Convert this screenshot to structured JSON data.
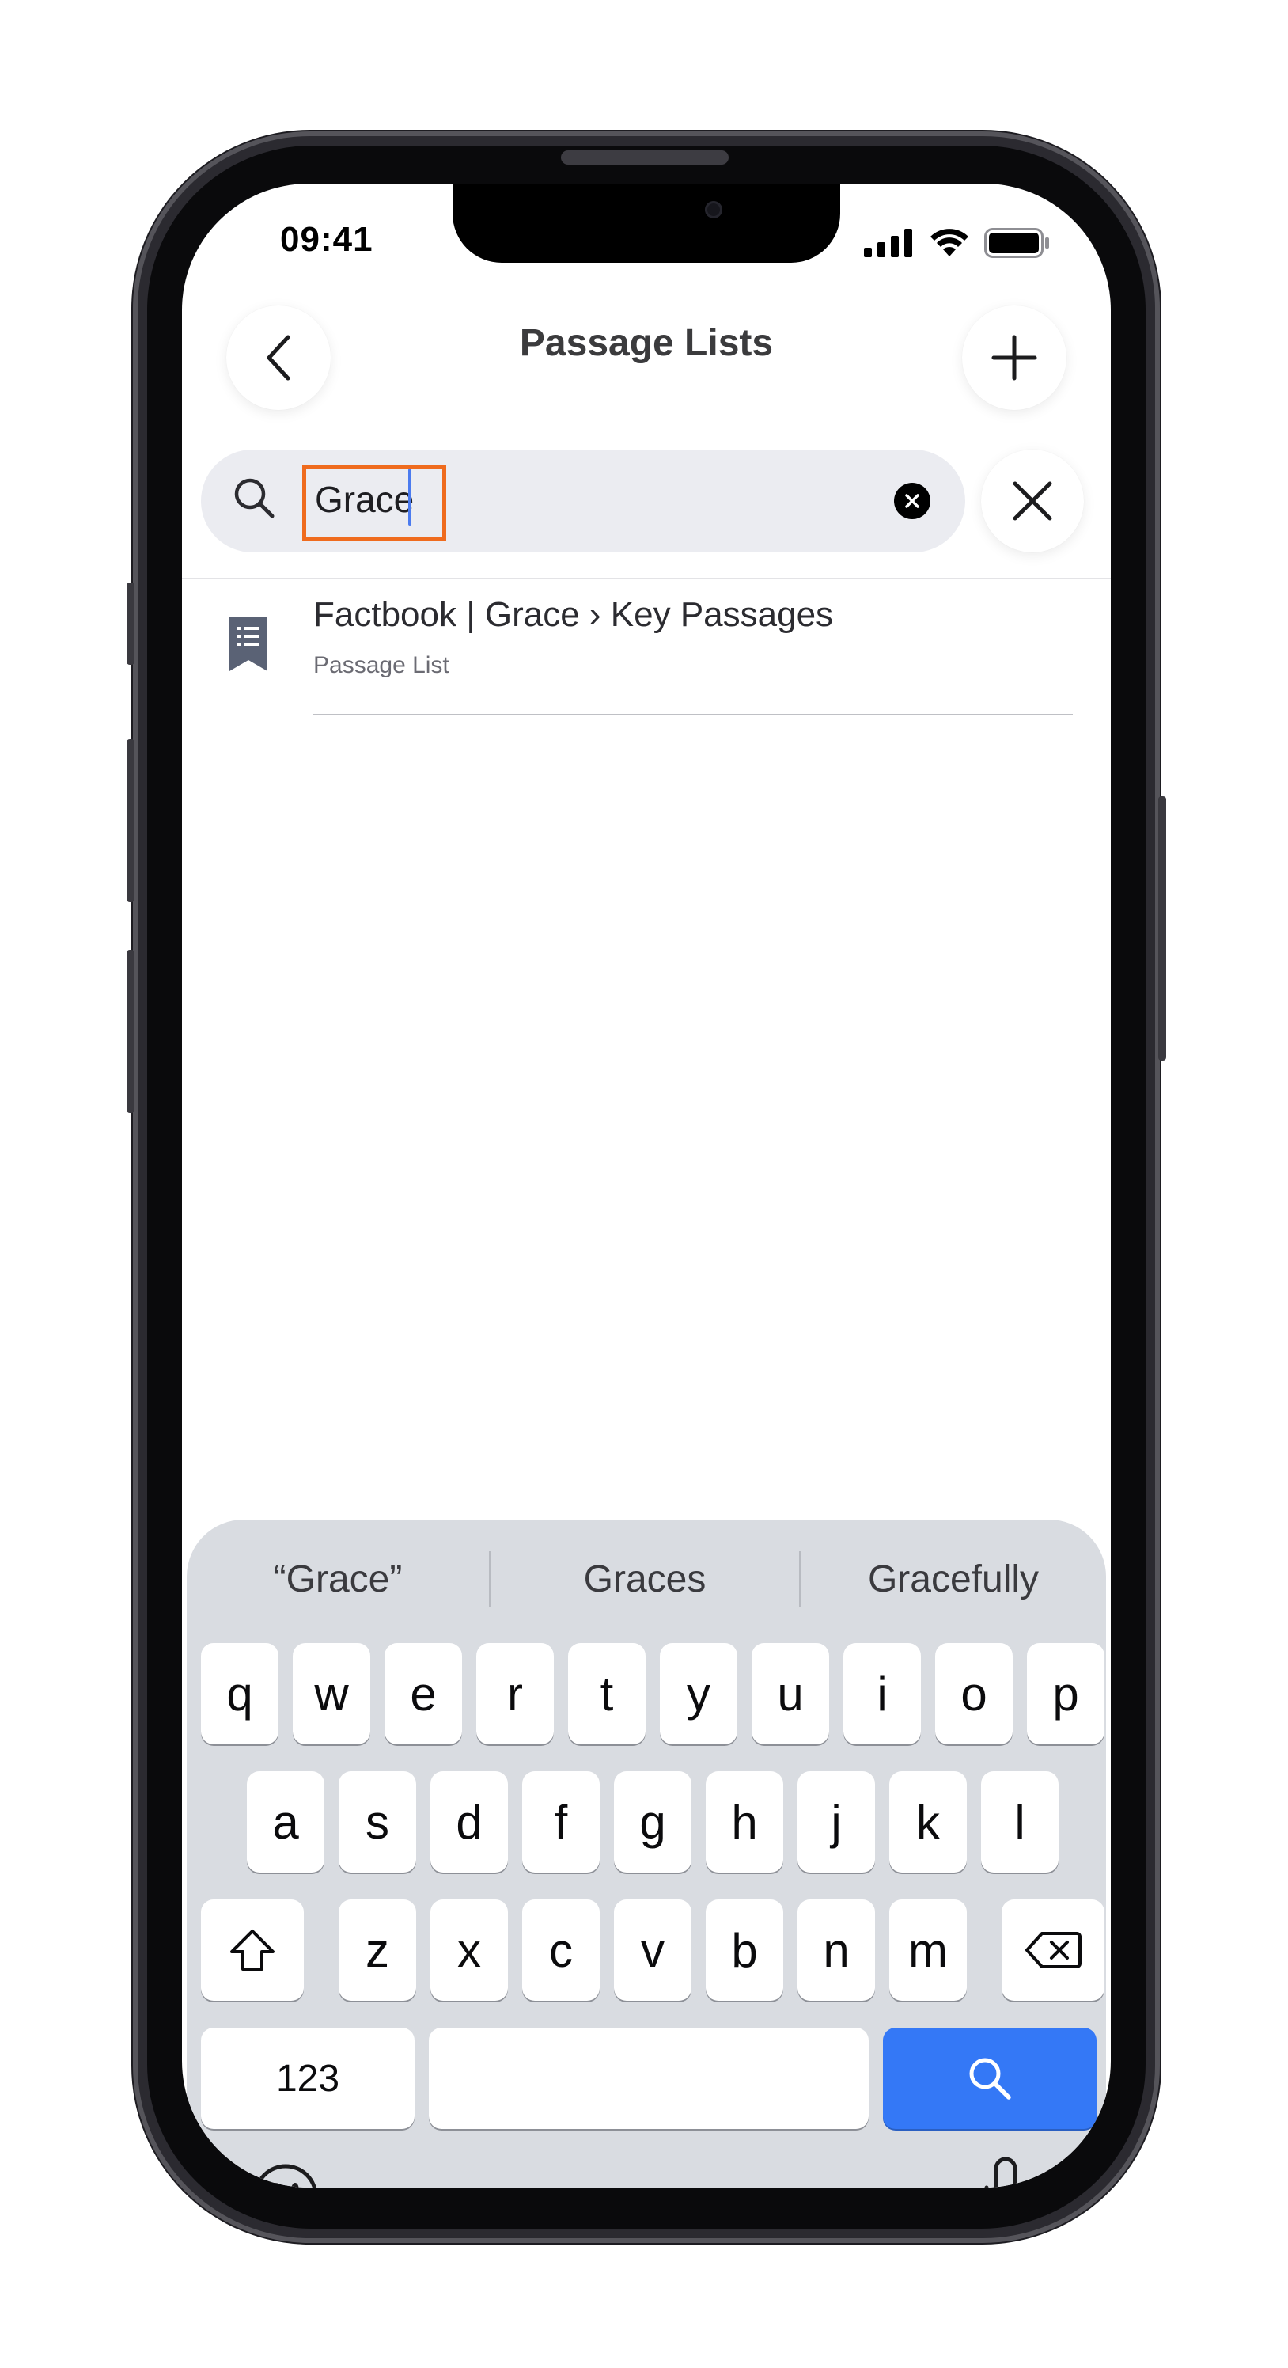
{
  "status": {
    "time": "09:41"
  },
  "nav": {
    "title": "Passage Lists"
  },
  "search": {
    "query": "Grace"
  },
  "results": [
    {
      "title": "Factbook | Grace › Key Passages",
      "subtitle": "Passage List"
    }
  ],
  "keyboard": {
    "suggestions": [
      "“Grace”",
      "Graces",
      "Gracefully"
    ],
    "row1": [
      "q",
      "w",
      "e",
      "r",
      "t",
      "y",
      "u",
      "i",
      "o",
      "p"
    ],
    "row2": [
      "a",
      "s",
      "d",
      "f",
      "g",
      "h",
      "j",
      "k",
      "l"
    ],
    "row3": [
      "z",
      "x",
      "c",
      "v",
      "b",
      "n",
      "m"
    ],
    "numbers_label": "123"
  },
  "colors": {
    "accent": "#3478f6",
    "highlight": "#ef6b1e"
  }
}
